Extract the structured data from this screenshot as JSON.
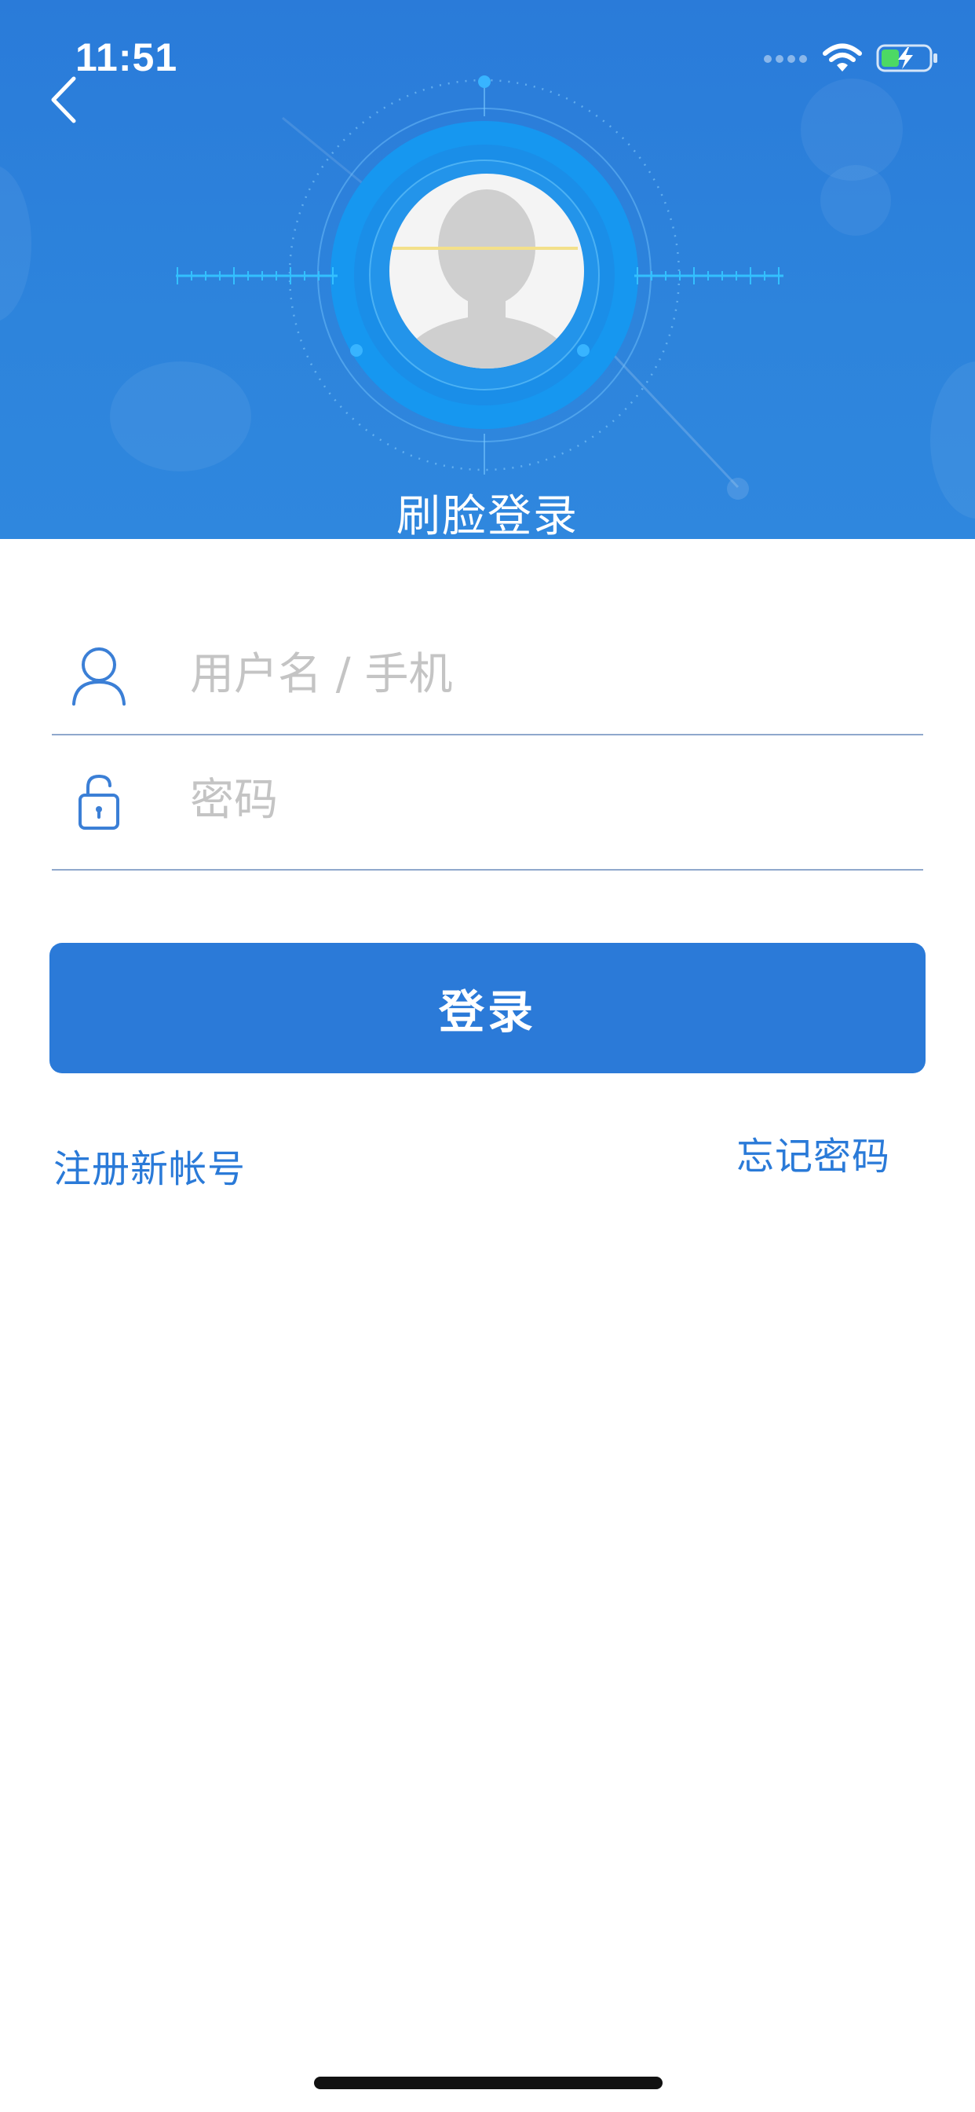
{
  "status_bar": {
    "time": "11:51"
  },
  "header": {
    "title": "刷脸登录",
    "background_color": "#2b7fdb",
    "ring_color": "#1aa3ff",
    "scan_line_color": "#f3e08a"
  },
  "form": {
    "username_placeholder": "用户名 / 手机",
    "password_placeholder": "密码",
    "login_label": "登录",
    "accent_color": "#2b7ad8"
  },
  "links": {
    "register": "注册新帐号",
    "forgot_password": "忘记密码"
  },
  "icons": {
    "back": "chevron-left-icon",
    "user": "user-icon",
    "lock": "unlock-icon",
    "wifi": "wifi-icon",
    "signal": "signal-icon",
    "battery": "battery-charging-icon",
    "avatar": "avatar-icon"
  }
}
